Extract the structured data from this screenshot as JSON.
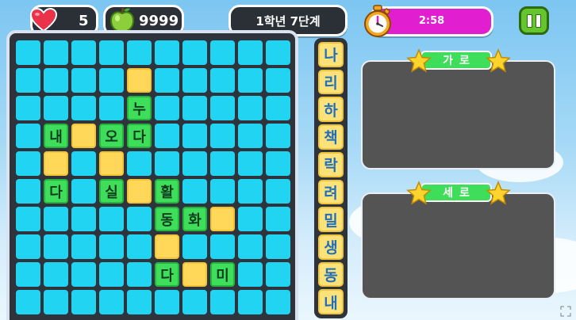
{
  "hud": {
    "lives": "5",
    "apples": "9999",
    "stage_title": "1학년 7단계",
    "timer": "2:58",
    "timer_remaining": 1.0,
    "icons": {
      "lives": "heart-icon",
      "apples": "green-apple-icon",
      "timer": "stopwatch-icon",
      "pause": "pause-icon"
    }
  },
  "board": {
    "rows": [
      [
        "",
        "",
        "",
        "",
        "",
        "",
        "",
        "",
        "",
        ""
      ],
      [
        "",
        "",
        "",
        "",
        "Y",
        "",
        "",
        "",
        "",
        ""
      ],
      [
        "",
        "",
        "",
        "",
        "누",
        "",
        "",
        "",
        "",
        ""
      ],
      [
        "",
        "내",
        "Y",
        "오",
        "다",
        "",
        "",
        "",
        "",
        ""
      ],
      [
        "",
        "Y",
        "",
        "Y",
        "",
        "",
        "",
        "",
        "",
        ""
      ],
      [
        "",
        "다",
        "",
        "실",
        "Y",
        "활",
        "",
        "",
        "",
        ""
      ],
      [
        "",
        "",
        "",
        "",
        "",
        "동",
        "화",
        "Y",
        "",
        ""
      ],
      [
        "",
        "",
        "",
        "",
        "",
        "Y",
        "",
        "",
        "",
        ""
      ],
      [
        "",
        "",
        "",
        "",
        "",
        "다",
        "Y",
        "미",
        "",
        ""
      ],
      [
        "",
        "",
        "",
        "",
        "",
        "",
        "",
        "",
        "",
        ""
      ]
    ]
  },
  "letters": [
    "나",
    "리",
    "하",
    "책",
    "락",
    "려",
    "밀",
    "생",
    "동",
    "내"
  ],
  "clues": {
    "across": {
      "title": "가로"
    },
    "down": {
      "title": "세로"
    }
  },
  "colors": {
    "empty_cell": "#20d4f2",
    "blank_cell": "#ffd85a",
    "filled_cell": "#3ede5a",
    "timer_bar": "#e21fd0",
    "letter_tile": "#fde27a"
  }
}
